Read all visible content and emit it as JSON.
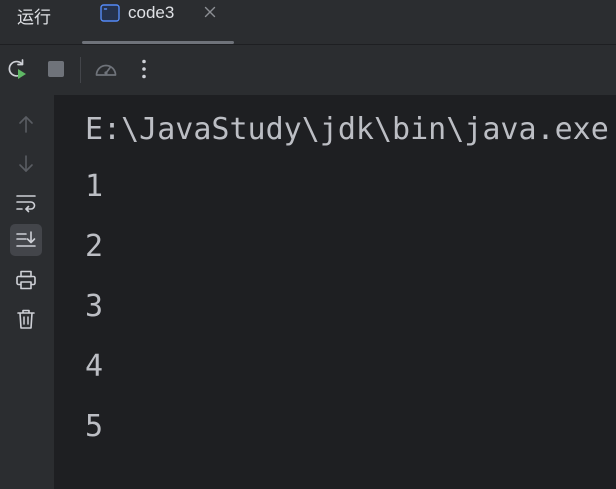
{
  "tool_window": {
    "title": "运行"
  },
  "tab": {
    "label": "code3"
  },
  "toolbar": {
    "buttons": [
      "rerun",
      "stop",
      "profiler",
      "more"
    ]
  },
  "sidebar": {
    "buttons": [
      "up",
      "down",
      "soft-wrap",
      "scroll-to-end",
      "print",
      "clear"
    ]
  },
  "console": {
    "lines": [
      "E:\\JavaStudy\\jdk\\bin\\java.exe",
      "1",
      "2",
      "3",
      "4",
      "5"
    ]
  },
  "colors": {
    "background": "#1e1f22",
    "panel": "#2b2d30",
    "text": "#bcbec4",
    "run_green": "#5fb865"
  }
}
